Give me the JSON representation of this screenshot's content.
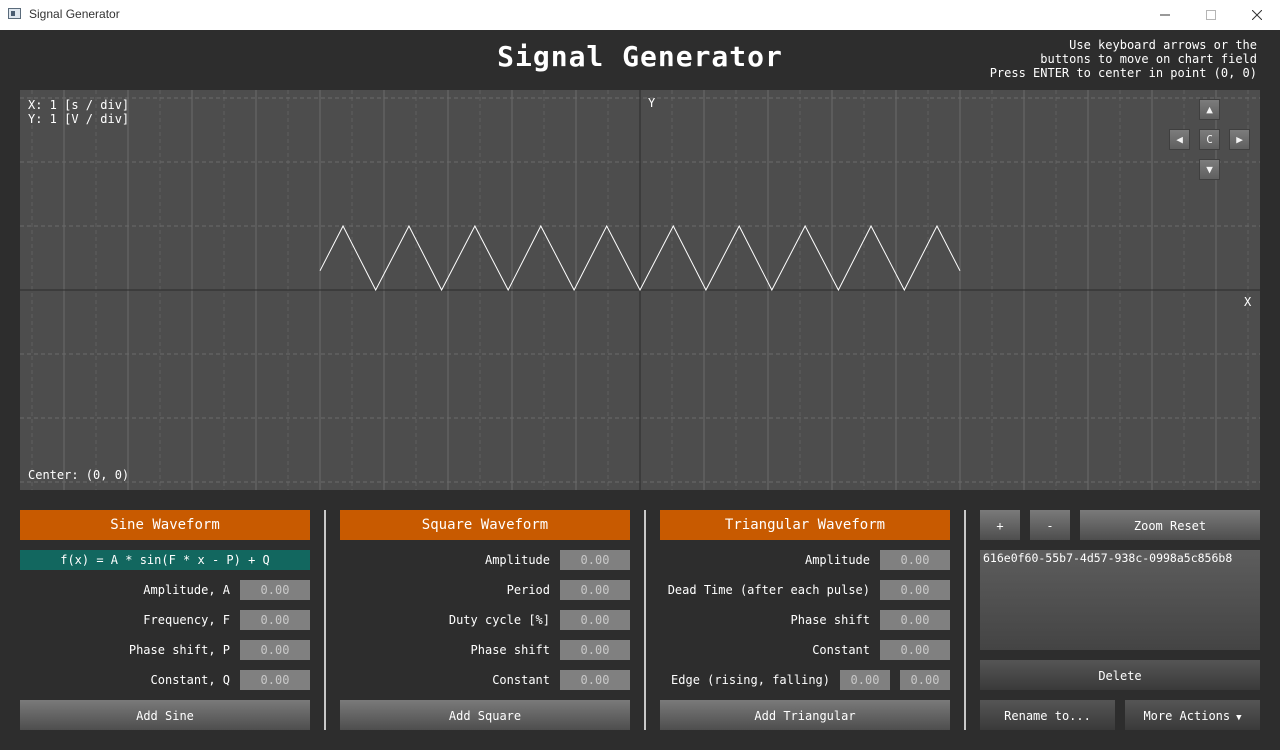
{
  "window": {
    "title": "Signal Generator"
  },
  "app": {
    "title": "Signal Generator",
    "hint": "Use keyboard arrows or the\nbuttons to move on chart field\nPress ENTER to center in point (0, 0)"
  },
  "chart": {
    "scale_x": "X: 1 [s / div]",
    "scale_y": "Y: 1 [V / div]",
    "axis_y": "Y",
    "axis_x": "X",
    "center": "Center: (0, 0)",
    "nav": {
      "up": "▲",
      "down": "▼",
      "left": "◀",
      "right": "▶",
      "center": "C"
    }
  },
  "chart_data": {
    "type": "line",
    "xlim": [
      -5,
      5
    ],
    "ylim": [
      -3,
      3
    ],
    "grid": true,
    "series": [
      {
        "x": [
          -5,
          -4.64,
          -4.13,
          -3.61,
          -3.1,
          -2.58,
          -2.06,
          -1.55,
          -1.03,
          -0.52,
          0,
          0.52,
          1.03,
          1.55,
          2.06,
          2.58,
          3.1,
          3.61,
          4.13,
          4.64,
          5
        ],
        "y": [
          0.3,
          1,
          0,
          1,
          0,
          1,
          0,
          1,
          0,
          1,
          0,
          1,
          0,
          1,
          0,
          1,
          0,
          1,
          0,
          1,
          0.3
        ]
      }
    ]
  },
  "sine": {
    "header": "Sine Waveform",
    "formula": "f(x) = A * sin(F * x - P) + Q",
    "fields": [
      {
        "label": "Amplitude, A",
        "value": "0.00"
      },
      {
        "label": "Frequency, F",
        "value": "0.00"
      },
      {
        "label": "Phase shift, P",
        "value": "0.00"
      },
      {
        "label": "Constant, Q",
        "value": "0.00"
      }
    ],
    "add_label": "Add Sine"
  },
  "square": {
    "header": "Square Waveform",
    "fields": [
      {
        "label": "Amplitude",
        "value": "0.00"
      },
      {
        "label": "Period",
        "value": "0.00"
      },
      {
        "label": "Duty cycle [%]",
        "value": "0.00"
      },
      {
        "label": "Phase shift",
        "value": "0.00"
      },
      {
        "label": "Constant",
        "value": "0.00"
      }
    ],
    "add_label": "Add Square"
  },
  "triangular": {
    "header": "Triangular Waveform",
    "fields": [
      {
        "label": "Amplitude",
        "value": "0.00"
      },
      {
        "label": "Dead Time (after each pulse)",
        "value": "0.00"
      },
      {
        "label": "Phase shift",
        "value": "0.00"
      },
      {
        "label": "Constant",
        "value": "0.00"
      }
    ],
    "edge": {
      "label": "Edge (rising, falling)",
      "rising": "0.00",
      "falling": "0.00"
    },
    "add_label": "Add Triangular"
  },
  "controls": {
    "zoom_in": "+",
    "zoom_out": "-",
    "zoom_reset": "Zoom Reset",
    "signals": [
      "616e0f60-55b7-4d57-938c-0998a5c856b8"
    ],
    "delete": "Delete",
    "rename": "Rename to...",
    "more": "More Actions"
  },
  "colors": {
    "accent": "#c85a00",
    "formula_bg": "#12675f",
    "chart_bg": "#4d4d4d",
    "app_bg": "#2d2d2d"
  }
}
